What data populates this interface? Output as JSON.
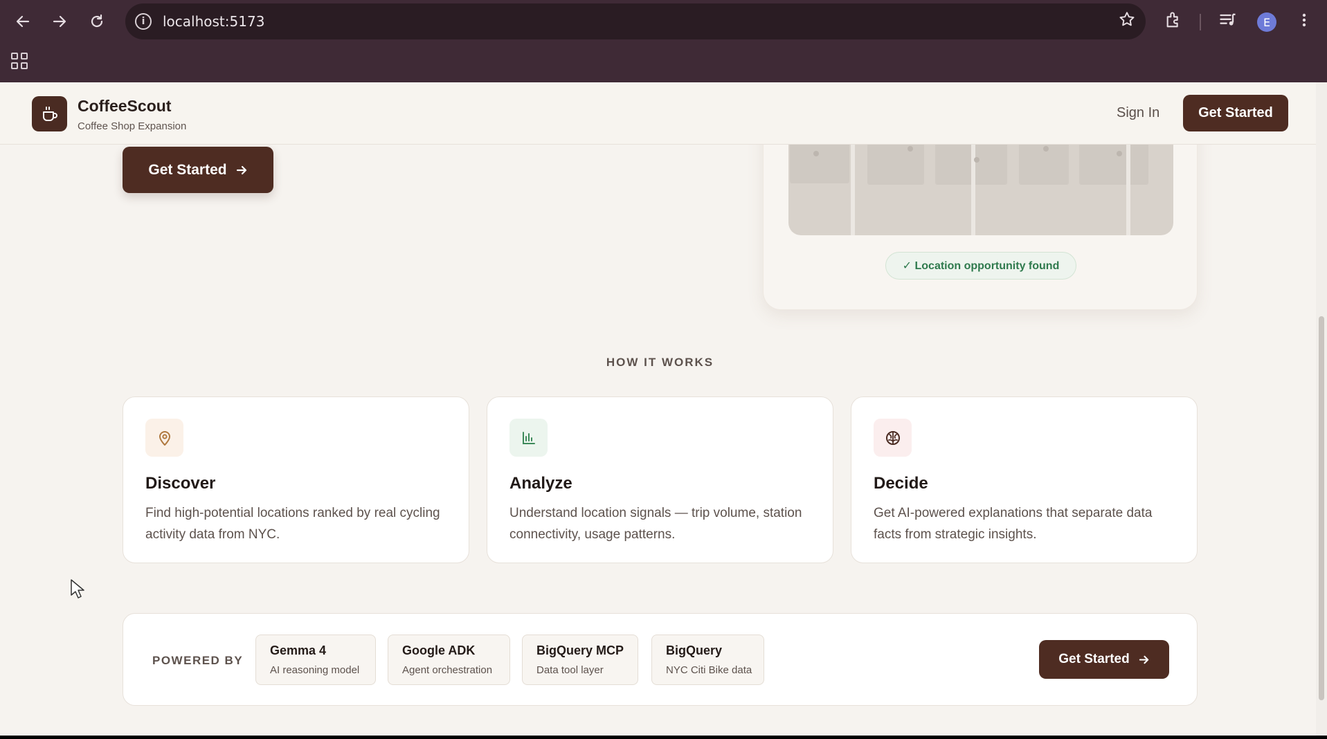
{
  "browser": {
    "url": "localhost:5173",
    "profile_initial": "E",
    "icons": [
      "back-icon",
      "forward-icon",
      "reload-icon",
      "info-icon",
      "star-icon",
      "extensions-icon",
      "media-icon",
      "menu-icon",
      "tab-grid-icon"
    ]
  },
  "header": {
    "brand_name": "CoffeeScout",
    "brand_sub": "Coffee Shop Expansion",
    "sign_in": "Sign In",
    "cta": "Get Started"
  },
  "hero": {
    "cta": "Get Started",
    "badge": "✓ Location opportunity found"
  },
  "how_it_works": {
    "title": "HOW IT WORKS",
    "steps": [
      {
        "title": "Discover",
        "desc": "Find high-potential locations ranked by real cycling activity data from NYC.",
        "icon": "map-pin-icon",
        "icon_bg": "#fbf1e8",
        "icon_color": "#b0793f"
      },
      {
        "title": "Analyze",
        "desc": "Understand location signals — trip volume, station connectivity, usage patterns.",
        "icon": "bar-chart-icon",
        "icon_bg": "#ecf5ee",
        "icon_color": "#3d8a5a"
      },
      {
        "title": "Decide",
        "desc": "Get AI-powered explanations that separate data facts from strategic insights.",
        "icon": "brain-icon",
        "icon_bg": "#fbeeee",
        "icon_color": "#4a2b22"
      }
    ]
  },
  "powered_by": {
    "label": "POWERED BY",
    "chips": [
      {
        "name": "Gemma 4",
        "sub": "AI reasoning model"
      },
      {
        "name": "Google ADK",
        "sub": "Agent orchestration"
      },
      {
        "name": "BigQuery MCP",
        "sub": "Data tool layer"
      },
      {
        "name": "BigQuery",
        "sub": "NYC Citi Bike data"
      }
    ],
    "cta": "Get Started"
  },
  "colors": {
    "brand_dark": "#4e2c22",
    "page_bg": "#f6f3ef",
    "success_green": "#2f7a4d",
    "chrome_bg": "#3f2a36"
  }
}
